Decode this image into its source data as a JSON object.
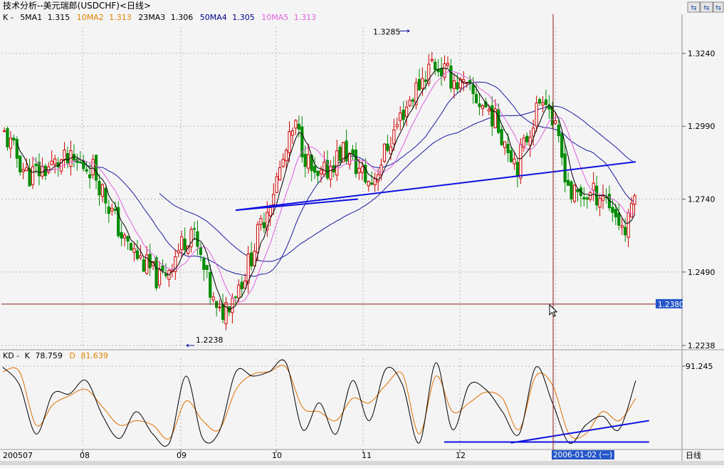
{
  "window_title": "技术分析--美元瑞郎(USDCHF)<日线>",
  "toolbar_buttons": [
    {
      "label": "⇆",
      "icon": "zoom-out-icon"
    },
    {
      "label": "⇆",
      "icon": "zoom-in-icon"
    },
    {
      "label": "⇆",
      "icon": "scroll-icon"
    }
  ],
  "ma_legend": [
    {
      "label": "K -",
      "color": "#000000"
    },
    {
      "label": "5MA1",
      "value": "1.315",
      "color": "#000000"
    },
    {
      "label": "10MA2",
      "value": "1.313",
      "color": "#e08000"
    },
    {
      "label": "23MA3",
      "value": "1.306",
      "color": "#000000"
    },
    {
      "label": "50MA4",
      "value": "1.305",
      "color": "#00008c"
    },
    {
      "label": "10MA5",
      "value": "1.313",
      "color": "#e060e0"
    }
  ],
  "kd_legend": [
    {
      "label": "KD - ",
      "color": "#000000"
    },
    {
      "label": "K",
      "value": "78.759",
      "color": "#000000"
    },
    {
      "label": "D",
      "value": "81.639",
      "color": "#e08000"
    }
  ],
  "colors": {
    "background": "#f4f4f4",
    "up_candle": "#cc0000",
    "down_candle": "#008c00",
    "ma_short": "#000000",
    "ma_pink": "#e060e0",
    "ma_long": "#1a1aa0",
    "trendline": "#1010e0",
    "k_line": "#000000",
    "d_line": "#e07000",
    "crosshair": "#8b1a1a",
    "price_tag_bg": "#2456c8"
  },
  "chart_data": [
    {
      "type": "candlestick",
      "title": "技术分析--美元瑞郎(USDCHF)<日线>",
      "ylim": [
        1.2238,
        1.3285
      ],
      "y_ticks": [
        1.2238,
        1.249,
        1.274,
        1.299,
        1.324
      ],
      "y_tick_labels": [
        "1.2238",
        "1.2490",
        "1.2740",
        "1.2990",
        "1.3240"
      ],
      "x_tick_labels": [
        "200507",
        "08",
        "09",
        "10",
        "11",
        "12",
        "2006-01-02 (一)"
      ],
      "x_axis_label": "日线",
      "annotations": [
        {
          "text": "1.3285",
          "price": 1.3285,
          "marker": "high"
        },
        {
          "text": "1.2238",
          "price": 1.2238,
          "marker": "low"
        }
      ],
      "crosshair": {
        "price": 1.238,
        "label": "1.2380",
        "date": "2006-01-02 (一)"
      },
      "trendlines": [
        {
          "from_date": "2005-09-20",
          "from_price": 1.2702,
          "to_date": "2006-01-20",
          "to_price": 1.2868
        },
        {
          "from_date": "2005-09-20",
          "from_price": 1.2702,
          "to_date": "2005-10-31",
          "to_price": 1.274
        }
      ],
      "series": [
        {
          "name": "5MA1",
          "summary_value": 1.315
        },
        {
          "name": "10MA2",
          "summary_value": 1.313
        },
        {
          "name": "23MA3",
          "summary_value": 1.306
        },
        {
          "name": "50MA4",
          "summary_value": 1.305
        },
        {
          "name": "10MA5",
          "summary_value": 1.313
        }
      ],
      "key_closes": [
        {
          "date": "2005-07-01",
          "close": 1.297
        },
        {
          "date": "2005-07-11",
          "close": 1.282
        },
        {
          "date": "2005-07-25",
          "close": 1.287
        },
        {
          "date": "2005-08-05",
          "close": 1.285
        },
        {
          "date": "2005-08-15",
          "close": 1.259
        },
        {
          "date": "2005-08-26",
          "close": 1.246
        },
        {
          "date": "2005-09-05",
          "close": 1.264
        },
        {
          "date": "2005-09-14",
          "close": 1.233
        },
        {
          "date": "2005-09-23",
          "close": 1.248
        },
        {
          "date": "2005-10-03",
          "close": 1.278
        },
        {
          "date": "2005-10-10",
          "close": 1.299
        },
        {
          "date": "2005-10-17",
          "close": 1.279
        },
        {
          "date": "2005-10-26",
          "close": 1.291
        },
        {
          "date": "2005-11-04",
          "close": 1.279
        },
        {
          "date": "2005-11-14",
          "close": 1.304
        },
        {
          "date": "2005-11-23",
          "close": 1.321
        },
        {
          "date": "2005-12-02",
          "close": 1.313
        },
        {
          "date": "2005-12-12",
          "close": 1.304
        },
        {
          "date": "2005-12-21",
          "close": 1.286
        },
        {
          "date": "2005-12-30",
          "close": 1.312
        },
        {
          "date": "2006-01-06",
          "close": 1.275
        },
        {
          "date": "2006-01-13",
          "close": 1.276
        },
        {
          "date": "2006-01-18",
          "close": 1.262
        },
        {
          "date": "2006-01-20",
          "close": 1.281
        }
      ]
    },
    {
      "type": "line",
      "title": "KD",
      "ylim": [
        0,
        100
      ],
      "y_ticks": [
        91.245
      ],
      "y_tick_labels": [
        "91.245"
      ],
      "series": [
        {
          "name": "K",
          "summary_value": 78.759,
          "values": [
            90,
            70,
            15,
            60,
            60,
            75,
            35,
            10,
            40,
            15,
            5,
            80,
            10,
            18,
            85,
            80,
            85,
            95,
            20,
            50,
            15,
            75,
            30,
            88,
            70,
            5,
            95,
            20,
            70,
            65,
            40,
            15,
            90,
            50,
            5,
            25,
            35,
            20,
            75
          ]
        },
        {
          "name": "D",
          "summary_value": 81.639,
          "values": [
            85,
            85,
            25,
            48,
            58,
            65,
            45,
            25,
            30,
            25,
            10,
            52,
            30,
            20,
            65,
            82,
            85,
            90,
            45,
            40,
            30,
            55,
            50,
            70,
            82,
            15,
            80,
            40,
            50,
            62,
            55,
            20,
            80,
            70,
            15,
            15,
            40,
            30,
            55
          ]
        }
      ],
      "trendlines": [
        {
          "from_index": 26.5,
          "from_value": 6,
          "to_index": 38.8,
          "to_value": 6
        },
        {
          "from_index": 30.5,
          "from_value": 5,
          "to_index": 38.8,
          "to_value": 30
        }
      ]
    }
  ]
}
